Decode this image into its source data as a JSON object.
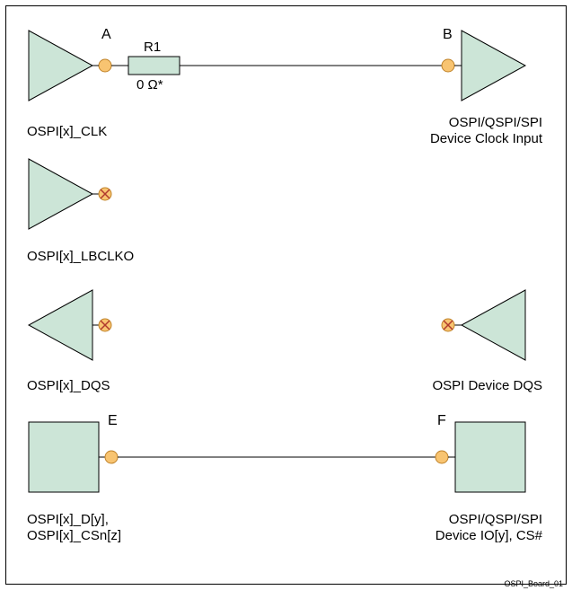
{
  "diagram": {
    "caption": "OSPI_Board_01",
    "resistor": {
      "name": "R1",
      "value": "0 Ω*"
    },
    "points": {
      "A": "A",
      "B": "B",
      "E": "E",
      "F": "F"
    },
    "left_labels": {
      "clk": "OSPI[x]_CLK",
      "lbclk": "OSPI[x]_LBCLKO",
      "dqs": "OSPI[x]_DQS",
      "io1": "OSPI[x]_D[y],",
      "io2": "OSPI[x]_CSn[z]"
    },
    "right_labels": {
      "clk1": "OSPI/QSPI/SPI",
      "clk2": "Device Clock Input",
      "dqs": "OSPI Device DQS",
      "io1": "OSPI/QSPI/SPI",
      "io2": "Device IO[y], CS#"
    }
  }
}
